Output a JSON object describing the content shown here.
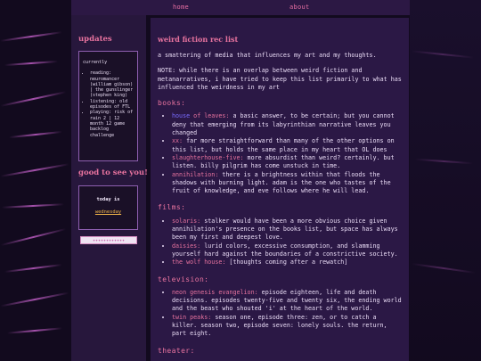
{
  "nav": {
    "home": "home",
    "about": "about"
  },
  "sidebar": {
    "updates_title": "updates",
    "currently_label": "currently",
    "currently_items": [
      "reading: neuromancer (william gibson) | the gunslinger (stephen king)",
      "listening: old episodes of FTL",
      "playing: risk of rain 2 | 12 month 12 game backlog challenge"
    ],
    "greeting_title": "good to see you!",
    "today_label": "today is",
    "today_value": "wednesday",
    "stamp_text": "✦✦✦✦✦✦✦✦✦✦✦✦"
  },
  "main": {
    "title": "weird fiction rec list",
    "intro": "a smattering of media that influences my art and my thoughts.",
    "note": "NOTE: while there is an overlap between weird fiction and metanarratives, i have tried to keep this list primarily to what has influenced the weirdness in my art",
    "sections": [
      {
        "heading": "books:",
        "items": [
          {
            "title_a": "house",
            "title_b": " of leaves:",
            "text": " a basic answer, to be certain; but you cannot deny that emerging from its labyrinthian narrative leaves you changed"
          },
          {
            "title": "xx:",
            "text": " far more straightforward than many of the other options on this list, but holds the same place in my heart that  OL does"
          },
          {
            "title": "slaughterhouse-five:",
            "text": " more absurdist than weird? certainly. but listen. billy pilgrim has come unstuck in time."
          },
          {
            "title": "annihilation:",
            "text": " there is a brightness within that floods the shadows with burning light. adam is the one who tastes of the fruit of knowledge, and eve follows where he will lead."
          }
        ]
      },
      {
        "heading": "films:",
        "items": [
          {
            "title": "solaris:",
            "text": " stalker would have been a more obvious choice given annihilation's presence on the books list, but space has always been my first and deepest love."
          },
          {
            "title": "daisies:",
            "text": " lurid colors, excessive consumption, and slamming yourself hard against the boundaries of a constrictive society."
          },
          {
            "title": "the wolf house:",
            "text": " [thoughts coming after a rewatch]"
          }
        ]
      },
      {
        "heading": "television:",
        "items": [
          {
            "title": "neon genesis evangelion:",
            "text": " episode eighteen, life and death decisions. episodes twenty-five and twenty six, the ending world and the beast who shouted 'i' at the heart of the world."
          },
          {
            "title": "twin peaks:",
            "text": " season one, episode three: zen, or to catch a killer. season two, episode seven: lonely souls. the return, part eight."
          }
        ]
      },
      {
        "heading": "theater:",
        "items": []
      }
    ]
  },
  "colors": {
    "accent": "#e8739f",
    "panel": "#2b1845",
    "sidebar": "#27173c",
    "link_blue": "#7a6cff",
    "today": "#f0b44a"
  }
}
